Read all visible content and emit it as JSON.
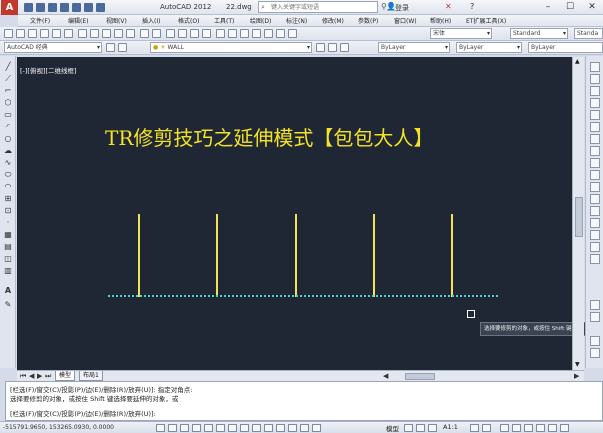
{
  "titlebar": {
    "app_title": "AutoCAD 2012",
    "file_name": "22.dwg",
    "search_placeholder": "键入关键字或短语",
    "login_label": "登录"
  },
  "menu": {
    "items": [
      "文件(F)",
      "编辑(E)",
      "视图(V)",
      "插入(I)",
      "格式(O)",
      "工具(T)",
      "绘图(D)",
      "标注(N)",
      "修改(M)",
      "参数(P)",
      "窗口(W)",
      "帮助(H)",
      "ET扩展工具(X)"
    ]
  },
  "toolbar": {
    "workspace": "AutoCAD 经典",
    "layer": "WALL",
    "color": "ByLayer",
    "linetype": "ByLayer",
    "lineweight": "ByLayer",
    "font": "宋体",
    "text_style": "Standard",
    "dim_style": "Standa"
  },
  "canvas": {
    "viewport_label": "[-][俯视][二维线框]",
    "drawing_title": "TR修剪技巧之延伸模式【包包大人】",
    "tooltip": "选择要修剪的对象，或按住 Shift 键选择"
  },
  "tabs": [
    "模型",
    "布局1"
  ],
  "command": {
    "line1": "[栏选(F)/窗交(C)/投影(P)/边(E)/删除(R)/放弃(U)]:  指定对角点:",
    "line2": "选择要修剪的对象，或按住 Shift 键选择要延伸的对象，或",
    "line3": "[栏选(F)/窗交(C)/投影(P)/边(E)/删除(R)/放弃(U)]:"
  },
  "status": {
    "coords": "-515791.9650, 153265.0930, 0.0000",
    "model_label": "模型",
    "scale_label": "A1:1"
  },
  "colors": {
    "canvas_bg": "#1f2634",
    "title_text": "#f4e324",
    "lines": "#f2e25a",
    "baseline": "#4fd3d1"
  }
}
